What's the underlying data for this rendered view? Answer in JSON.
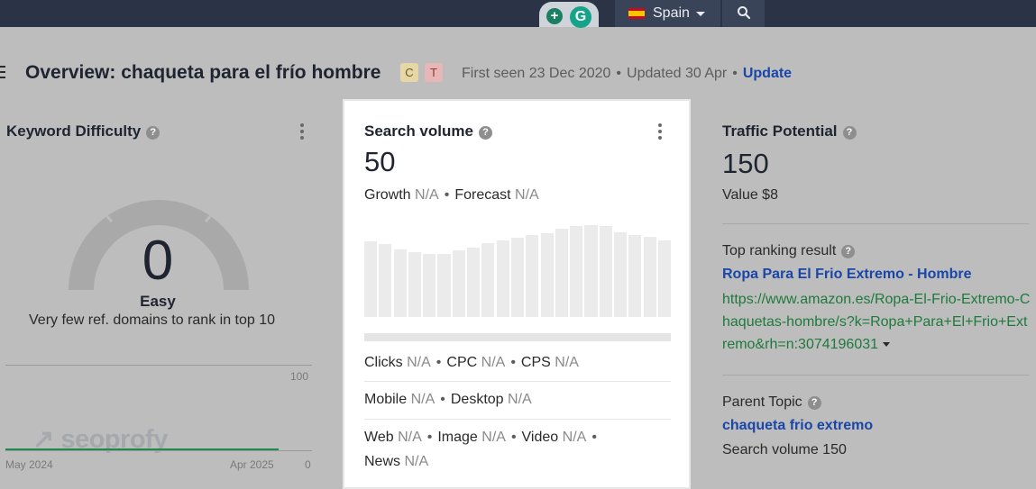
{
  "topbar": {
    "country": "Spain",
    "icons": [
      "plus-circle-icon",
      "grammarly-icon",
      "spain-flag-icon",
      "chevron-down-icon",
      "search-icon"
    ]
  },
  "header": {
    "title": "Overview: chaqueta para el frío hombre",
    "tags": [
      "C",
      "T"
    ],
    "first_seen": "First seen 23 Dec 2020",
    "updated": "Updated 30 Apr",
    "update_label": "Update"
  },
  "keyword_difficulty": {
    "title": "Keyword Difficulty",
    "value": "0",
    "label": "Easy",
    "description": "Very few ref. domains to rank in top 10",
    "axis_max": "100",
    "axis_min": "0",
    "date_start": "May 2024",
    "date_end": "Apr 2025",
    "watermark": "seoprofy"
  },
  "search_volume": {
    "title": "Search volume",
    "value": "50",
    "growth_label": "Growth",
    "forecast_label": "Forecast",
    "na": "N/A",
    "bar_levels": [
      0.79,
      0.76,
      0.71,
      0.68,
      0.66,
      0.66,
      0.7,
      0.73,
      0.77,
      0.8,
      0.83,
      0.86,
      0.88,
      0.92,
      0.95,
      0.96,
      0.95,
      0.89,
      0.86,
      0.84,
      0.8
    ],
    "metrics_row1": [
      "Clicks",
      "CPC",
      "CPS"
    ],
    "metrics_row2": [
      "Mobile",
      "Desktop"
    ],
    "metrics_row3": [
      "Web",
      "Image",
      "Video"
    ],
    "news_label": "News"
  },
  "traffic_potential": {
    "title": "Traffic Potential",
    "value": "150",
    "value_label": "Value $8",
    "top_result_label": "Top ranking result",
    "top_result_title": "Ropa Para El Frio Extremo - Hombre",
    "top_result_url": "https://www.amazon.es/Ropa-El-Frio-Extremo-Chaquetas-hombre/s?k=Ropa+Para+El+Frio+Extremo&rh=n:3074196031",
    "parent_topic_label": "Parent Topic",
    "parent_topic": "chaqueta frio extremo",
    "parent_volume": "Search volume 150"
  }
}
